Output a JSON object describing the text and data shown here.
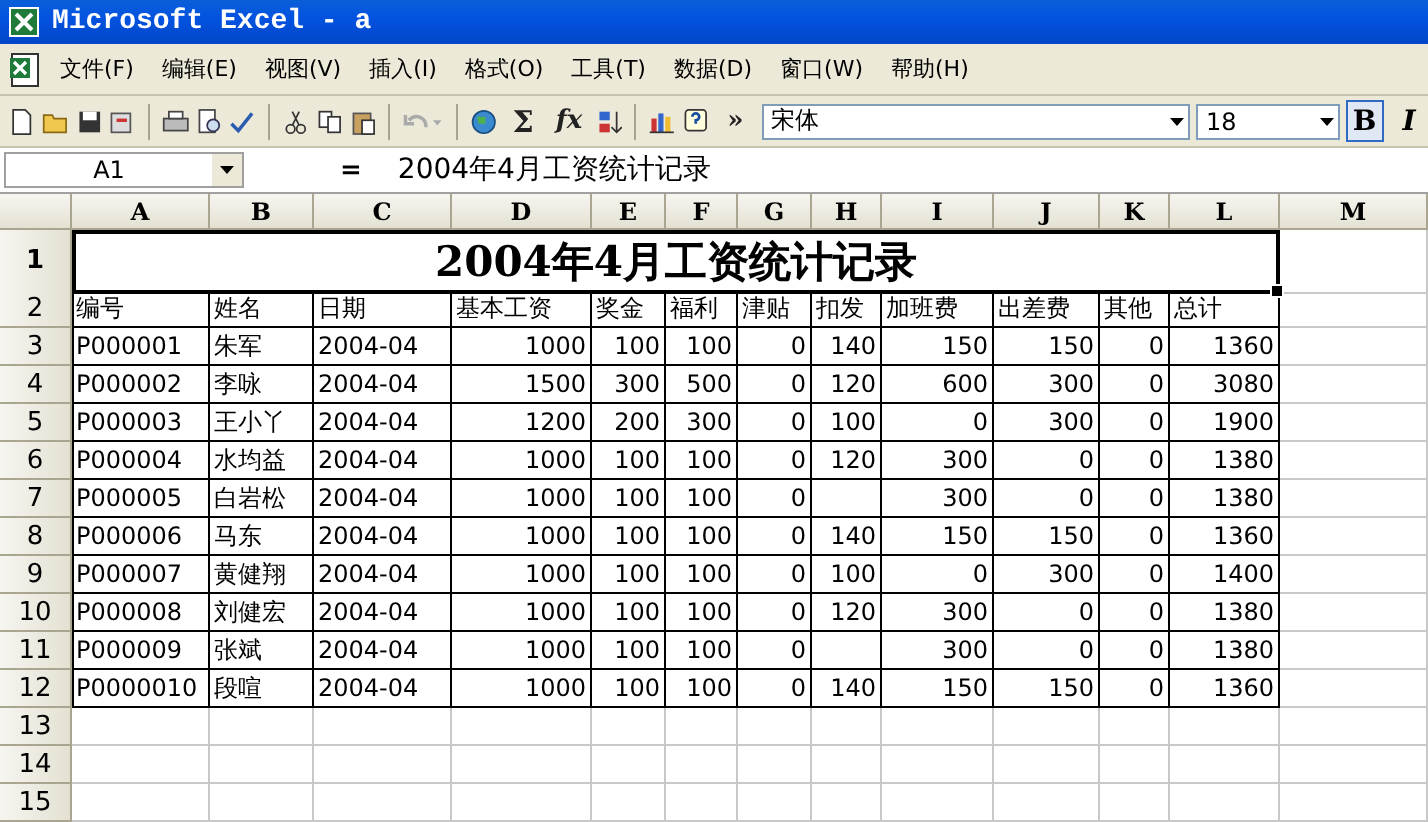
{
  "window": {
    "title": "Microsoft Excel - a"
  },
  "menu": [
    "文件(F)",
    "编辑(E)",
    "视图(V)",
    "插入(I)",
    "格式(O)",
    "工具(T)",
    "数据(D)",
    "窗口(W)",
    "帮助(H)"
  ],
  "toolbar": {
    "undo_disabled": true,
    "sum": "Σ",
    "function": "fx",
    "more": "»",
    "font_name": "宋体",
    "font_size": "18",
    "bold": "B",
    "italic": "I"
  },
  "formula_bar": {
    "name_box": "A1",
    "equals": "=",
    "content": "2004年4月工资统计记录"
  },
  "columns": [
    "A",
    "B",
    "C",
    "D",
    "E",
    "F",
    "G",
    "H",
    "I",
    "J",
    "K",
    "L",
    "M"
  ],
  "title_row": {
    "number": "1",
    "text": "2004年4月工资统计记录",
    "selected": true
  },
  "rows": [
    {
      "number": "2",
      "cells": [
        "编号",
        "姓名",
        "日期",
        "基本工资",
        "奖金",
        "福利",
        "津贴",
        "扣发",
        "加班费",
        "出差费",
        "其他",
        "总计"
      ]
    },
    {
      "number": "3",
      "cells": [
        "P000001",
        "朱军",
        "2004-04",
        "1000",
        "100",
        "100",
        "0",
        "140",
        "150",
        "150",
        "0",
        "1360"
      ]
    },
    {
      "number": "4",
      "cells": [
        "P000002",
        "李咏",
        "2004-04",
        "1500",
        "300",
        "500",
        "0",
        "120",
        "600",
        "300",
        "0",
        "3080"
      ]
    },
    {
      "number": "5",
      "cells": [
        "P000003",
        "王小丫",
        "2004-04",
        "1200",
        "200",
        "300",
        "0",
        "100",
        "0",
        "300",
        "0",
        "1900"
      ]
    },
    {
      "number": "6",
      "cells": [
        "P000004",
        "水均益",
        "2004-04",
        "1000",
        "100",
        "100",
        "0",
        "120",
        "300",
        "0",
        "0",
        "1380"
      ]
    },
    {
      "number": "7",
      "cells": [
        "P000005",
        "白岩松",
        "2004-04",
        "1000",
        "100",
        "100",
        "0",
        "",
        "300",
        "0",
        "0",
        "1380"
      ]
    },
    {
      "number": "8",
      "cells": [
        "P000006",
        "马东",
        "2004-04",
        "1000",
        "100",
        "100",
        "0",
        "140",
        "150",
        "150",
        "0",
        "1360"
      ]
    },
    {
      "number": "9",
      "cells": [
        "P000007",
        "黄健翔",
        "2004-04",
        "1000",
        "100",
        "100",
        "0",
        "100",
        "0",
        "300",
        "0",
        "1400"
      ]
    },
    {
      "number": "10",
      "cells": [
        "P000008",
        "刘健宏",
        "2004-04",
        "1000",
        "100",
        "100",
        "0",
        "120",
        "300",
        "0",
        "0",
        "1380"
      ]
    },
    {
      "number": "11",
      "cells": [
        "P000009",
        "张斌",
        "2004-04",
        "1000",
        "100",
        "100",
        "0",
        "",
        "300",
        "0",
        "0",
        "1380"
      ]
    },
    {
      "number": "12",
      "cells": [
        "P0000010",
        "段喧",
        "2004-04",
        "1000",
        "100",
        "100",
        "0",
        "140",
        "150",
        "150",
        "0",
        "1360"
      ]
    },
    {
      "number": "13",
      "cells": []
    },
    {
      "number": "14",
      "cells": []
    },
    {
      "number": "15",
      "cells": []
    }
  ]
}
